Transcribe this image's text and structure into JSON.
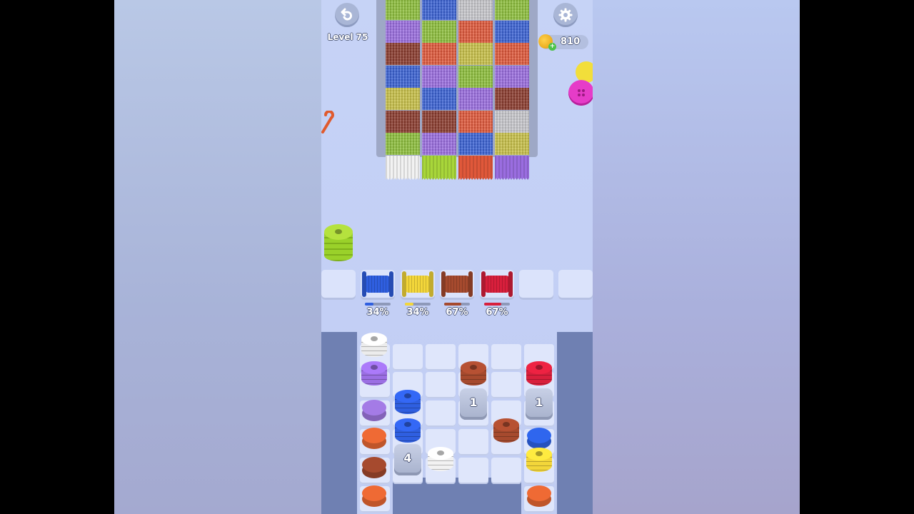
{
  "header": {
    "level_label": "Level 75",
    "coins": "810",
    "undo_icon": "undo-arrow-icon",
    "settings_icon": "gear-icon"
  },
  "spool_tray": [
    {
      "color": "#2f5fe0",
      "label": "34%",
      "progress": 0.34
    },
    {
      "color": "#f3d63a",
      "label": "34%",
      "progress": 0.34
    },
    {
      "color": "#a64a2e",
      "label": "67%",
      "progress": 0.67
    },
    {
      "color": "#d81f3c",
      "label": "67%",
      "progress": 0.67
    }
  ],
  "hidden_stacks": [
    {
      "count": "1"
    },
    {
      "count": "1"
    },
    {
      "count": "4"
    }
  ],
  "colors": {
    "green": "#8dbf3c",
    "blue": "#3a62d4",
    "grey": "#c8c8cc",
    "purple": "#9a6de0",
    "red_brown": "#8b3b2e",
    "orange": "#e0583a",
    "yellow": "#c8c048",
    "lime": "#a8d63a",
    "white": "#f2f2f2"
  }
}
